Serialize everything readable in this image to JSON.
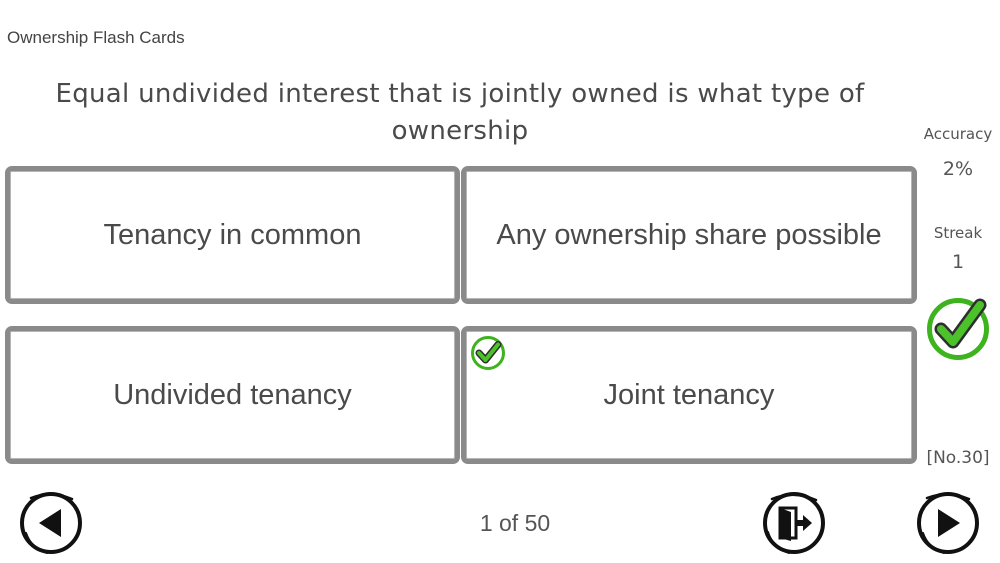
{
  "app": {
    "title": "Ownership Flash Cards"
  },
  "question": {
    "text": "Equal undivided interest that is jointly owned is what type of ownership"
  },
  "answers": [
    {
      "label": "Tenancy in common",
      "correct": false
    },
    {
      "label": "Any ownership share possible",
      "correct": false
    },
    {
      "label": "Undivided tenancy",
      "correct": false
    },
    {
      "label": "Joint tenancy",
      "correct": true
    }
  ],
  "stats": {
    "accuracy_label": "Accuracy",
    "accuracy_value": "2%",
    "streak_label": "Streak",
    "streak_value": "1",
    "card_number": "[No.30]",
    "result_icon": "check-circle-icon"
  },
  "footer": {
    "counter": "1 of 50",
    "prev_icon": "arrow-left-circle-icon",
    "exit_icon": "exit-door-icon",
    "next_icon": "arrow-right-circle-icon"
  },
  "colors": {
    "card_border": "#8a8a8a",
    "text": "#4a4a4a",
    "check_green": "#3db31e",
    "icon_dark": "#111111"
  }
}
